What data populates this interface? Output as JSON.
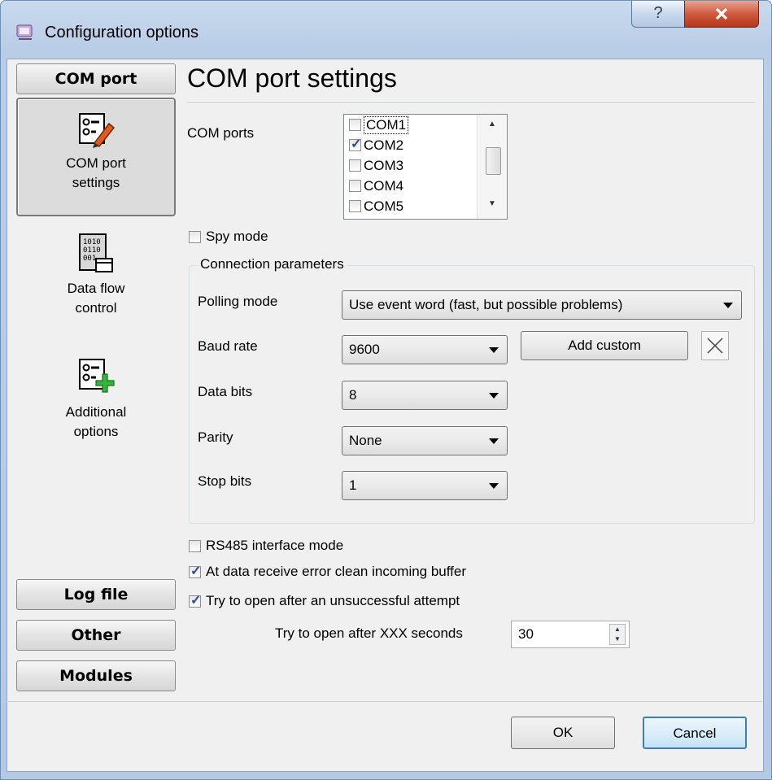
{
  "window": {
    "title": "Configuration options",
    "help_label": "?",
    "close_label": "X"
  },
  "sidebar": {
    "top_button": "COM port",
    "items": [
      {
        "label_line1": "COM port",
        "label_line2": "settings",
        "icon": "settings-pencil-icon"
      },
      {
        "label_line1": "Data flow",
        "label_line2": "control",
        "icon": "binary-data-icon"
      },
      {
        "label_line1": "Additional",
        "label_line2": "options",
        "icon": "add-options-icon"
      }
    ],
    "bottom_buttons": [
      "Log file",
      "Other",
      "Modules"
    ]
  },
  "main": {
    "heading": "COM port settings",
    "com_ports_label": "COM ports",
    "com_ports": [
      {
        "name": "COM1",
        "checked": false
      },
      {
        "name": "COM2",
        "checked": true
      },
      {
        "name": "COM3",
        "checked": false
      },
      {
        "name": "COM4",
        "checked": false
      },
      {
        "name": "COM5",
        "checked": false
      }
    ],
    "spy_mode_label": "Spy mode",
    "connection_group_title": "Connection parameters",
    "polling_mode_label": "Polling mode",
    "polling_mode_value": "Use event word (fast, but possible problems)",
    "baud_rate_label": "Baud rate",
    "baud_rate_value": "9600",
    "add_custom_label": "Add custom",
    "data_bits_label": "Data bits",
    "data_bits_value": "8",
    "parity_label": "Parity",
    "parity_value": "None",
    "stop_bits_label": "Stop bits",
    "stop_bits_value": "1",
    "rs485_label": "RS485 interface mode",
    "clean_buffer_label": "At data receive error clean incoming buffer",
    "retry_label": "Try to open after an unsuccessful attempt",
    "retry_seconds_label": "Try to open after XXX seconds",
    "retry_seconds_value": "30"
  },
  "footer": {
    "ok_label": "OK",
    "cancel_label": "Cancel"
  }
}
